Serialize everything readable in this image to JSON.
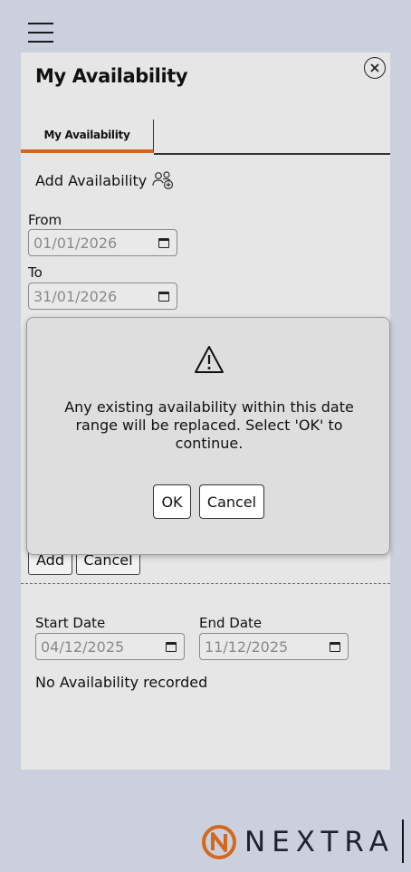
{
  "panel": {
    "title": "My Availability"
  },
  "tabs": [
    {
      "label": "My Availability"
    }
  ],
  "add_availability": {
    "label": "Add Availability",
    "icon": "people-add-icon"
  },
  "from": {
    "label": "From",
    "value": "01/01/2026"
  },
  "to": {
    "label": "To",
    "value": "31/01/2026"
  },
  "form_buttons": {
    "add_label": "Add",
    "cancel_label": "Cancel"
  },
  "filter": {
    "start_label": "Start Date",
    "start_value": "04/12/2025",
    "end_label": "End Date",
    "end_value": "11/12/2025"
  },
  "empty_message": "No Availability recorded",
  "dialog": {
    "icon": "warning-icon",
    "message": "Any existing availability within this date range will be replaced. Select 'OK' to continue.",
    "ok_label": "OK",
    "cancel_label": "Cancel"
  },
  "brand": {
    "name": "NEXTRA",
    "accent": "#d2691e"
  }
}
